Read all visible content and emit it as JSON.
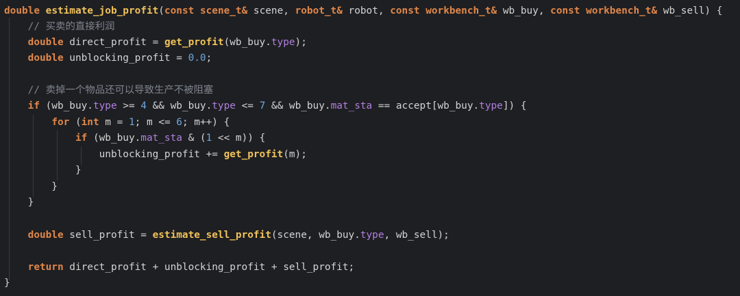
{
  "editor": {
    "language": "cpp",
    "colors": {
      "background": "#1e1f22",
      "keyword": "#e0874a",
      "function": "#f0c25a",
      "number": "#6ea8e0",
      "property": "#b07fe0",
      "comment": "#7f848e",
      "plain": "#d4d4d4"
    },
    "lines": [
      [
        {
          "c": "kw",
          "t": "double"
        },
        {
          "c": "pl",
          "t": " "
        },
        {
          "c": "fn",
          "t": "estimate_job_profit"
        },
        {
          "c": "pl",
          "t": "("
        },
        {
          "c": "kw",
          "t": "const"
        },
        {
          "c": "pl",
          "t": " "
        },
        {
          "c": "ty",
          "t": "scene_t&"
        },
        {
          "c": "pl",
          "t": " scene, "
        },
        {
          "c": "ty",
          "t": "robot_t&"
        },
        {
          "c": "pl",
          "t": " robot, "
        },
        {
          "c": "kw",
          "t": "const"
        },
        {
          "c": "pl",
          "t": " "
        },
        {
          "c": "ty",
          "t": "workbench_t&"
        },
        {
          "c": "pl",
          "t": " wb_buy, "
        },
        {
          "c": "kw",
          "t": "const"
        },
        {
          "c": "pl",
          "t": " "
        },
        {
          "c": "ty",
          "t": "workbench_t&"
        },
        {
          "c": "pl",
          "t": " wb_sell) {"
        }
      ],
      [
        {
          "c": "pl",
          "t": "    "
        },
        {
          "c": "cm",
          "t": "// "
        },
        {
          "c": "cm cjk",
          "t": "买卖的直接利润"
        }
      ],
      [
        {
          "c": "pl",
          "t": "    "
        },
        {
          "c": "kw",
          "t": "double"
        },
        {
          "c": "pl",
          "t": " direct_profit = "
        },
        {
          "c": "fn",
          "t": "get_profit"
        },
        {
          "c": "pl",
          "t": "(wb_buy."
        },
        {
          "c": "prop",
          "t": "type"
        },
        {
          "c": "pl",
          "t": ");"
        }
      ],
      [
        {
          "c": "pl",
          "t": "    "
        },
        {
          "c": "kw",
          "t": "double"
        },
        {
          "c": "pl",
          "t": " unblocking_profit = "
        },
        {
          "c": "num",
          "t": "0.0"
        },
        {
          "c": "pl",
          "t": ";"
        }
      ],
      [],
      [
        {
          "c": "pl",
          "t": "    "
        },
        {
          "c": "cm",
          "t": "// "
        },
        {
          "c": "cm cjk",
          "t": "卖掉一个物品还可以导致生产不被阻塞"
        }
      ],
      [
        {
          "c": "pl",
          "t": "    "
        },
        {
          "c": "kw",
          "t": "if"
        },
        {
          "c": "pl",
          "t": " (wb_buy."
        },
        {
          "c": "prop",
          "t": "type"
        },
        {
          "c": "pl",
          "t": " >= "
        },
        {
          "c": "num",
          "t": "4"
        },
        {
          "c": "pl",
          "t": " && wb_buy."
        },
        {
          "c": "prop",
          "t": "type"
        },
        {
          "c": "pl",
          "t": " <= "
        },
        {
          "c": "num",
          "t": "7"
        },
        {
          "c": "pl",
          "t": " && wb_buy."
        },
        {
          "c": "prop",
          "t": "mat_sta"
        },
        {
          "c": "pl",
          "t": " == accept[wb_buy."
        },
        {
          "c": "prop",
          "t": "type"
        },
        {
          "c": "pl",
          "t": "]) {"
        }
      ],
      [
        {
          "c": "pl",
          "t": "        "
        },
        {
          "c": "kw",
          "t": "for"
        },
        {
          "c": "pl",
          "t": " ("
        },
        {
          "c": "kw",
          "t": "int"
        },
        {
          "c": "pl",
          "t": " m = "
        },
        {
          "c": "num",
          "t": "1"
        },
        {
          "c": "pl",
          "t": "; m <= "
        },
        {
          "c": "num",
          "t": "6"
        },
        {
          "c": "pl",
          "t": "; m++) {"
        }
      ],
      [
        {
          "c": "pl",
          "t": "            "
        },
        {
          "c": "kw",
          "t": "if"
        },
        {
          "c": "pl",
          "t": " (wb_buy."
        },
        {
          "c": "prop",
          "t": "mat_sta"
        },
        {
          "c": "pl",
          "t": " & ("
        },
        {
          "c": "num",
          "t": "1"
        },
        {
          "c": "pl",
          "t": " << m)) {"
        }
      ],
      [
        {
          "c": "pl",
          "t": "                unblocking_profit += "
        },
        {
          "c": "fn",
          "t": "get_profit"
        },
        {
          "c": "pl",
          "t": "(m);"
        }
      ],
      [
        {
          "c": "pl",
          "t": "            }"
        }
      ],
      [
        {
          "c": "pl",
          "t": "        }"
        }
      ],
      [
        {
          "c": "pl",
          "t": "    }"
        }
      ],
      [],
      [
        {
          "c": "pl",
          "t": "    "
        },
        {
          "c": "kw",
          "t": "double"
        },
        {
          "c": "pl",
          "t": " sell_profit = "
        },
        {
          "c": "fn",
          "t": "estimate_sell_profit"
        },
        {
          "c": "pl",
          "t": "(scene, wb_buy."
        },
        {
          "c": "prop",
          "t": "type"
        },
        {
          "c": "pl",
          "t": ", wb_sell);"
        }
      ],
      [],
      [
        {
          "c": "pl",
          "t": "    "
        },
        {
          "c": "kw",
          "t": "return"
        },
        {
          "c": "pl",
          "t": " direct_profit + unblocking_profit + sell_profit;"
        }
      ],
      [
        {
          "c": "pl",
          "t": "}"
        }
      ]
    ]
  }
}
